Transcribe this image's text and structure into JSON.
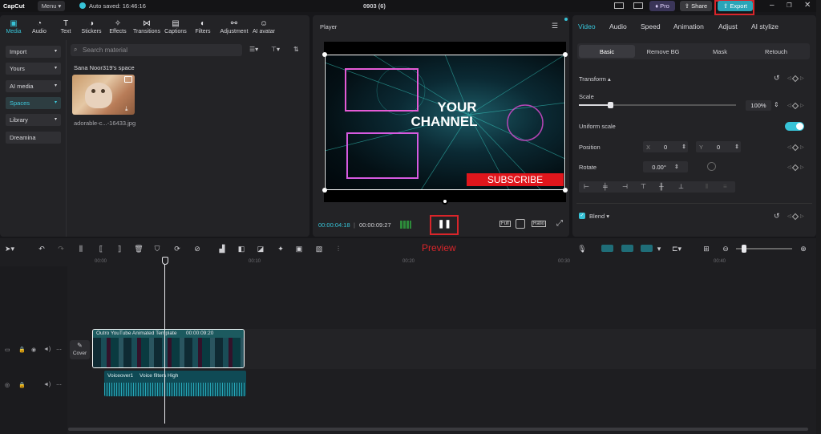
{
  "titlebar": {
    "app_name": "CapCut",
    "menu_label": "Menu",
    "autosave": "Auto saved: 16:46:16",
    "project_name": "0903 (6)",
    "pro_label": "Pro",
    "share_label": "Share",
    "export_label": "Export"
  },
  "toolbar": [
    {
      "label": "Media",
      "icon": "media-icon",
      "active": true
    },
    {
      "label": "Audio",
      "icon": "audio-icon"
    },
    {
      "label": "Text",
      "icon": "text-icon"
    },
    {
      "label": "Stickers",
      "icon": "stickers-icon"
    },
    {
      "label": "Effects",
      "icon": "effects-icon"
    },
    {
      "label": "Transitions",
      "icon": "transitions-icon"
    },
    {
      "label": "Captions",
      "icon": "captions-icon"
    },
    {
      "label": "Filters",
      "icon": "filters-icon"
    },
    {
      "label": "Adjustment",
      "icon": "adjustment-icon"
    },
    {
      "label": "AI avatar",
      "icon": "ai-avatar-icon"
    }
  ],
  "media": {
    "sidebar": [
      "Import",
      "Yours",
      "AI media",
      "Spaces",
      "Library",
      "Dreamina"
    ],
    "search_placeholder": "Search material",
    "space_title": "Sana Noor319's space",
    "file_name": "adorable-c...-16433.jpg"
  },
  "player": {
    "title": "Player",
    "video_text_1": "YOUR",
    "video_text_2": "CHANNEL",
    "subscribe_text": "SUBSCRIBE",
    "current_time": "00:00:04:18",
    "total_time": "00:00:09:27",
    "full_label": "Full",
    "ratio_label": "Ratio"
  },
  "inspector": {
    "tabs": [
      "Video",
      "Audio",
      "Speed",
      "Animation",
      "Adjust",
      "AI stylize"
    ],
    "subtabs": [
      "Basic",
      "Remove BG",
      "Mask",
      "Retouch"
    ],
    "transform_label": "Transform",
    "scale_label": "Scale",
    "scale_value": "100%",
    "scale_fraction": 0.2,
    "uniform_scale_label": "Uniform scale",
    "position_label": "Position",
    "pos_x_label": "X",
    "pos_x": "0",
    "pos_y_label": "Y",
    "pos_y": "0",
    "rotate_label": "Rotate",
    "rotate_value": "0.00°",
    "blend_label": "Blend"
  },
  "timeline": {
    "preview_label": "Preview",
    "ticks": [
      "00:00",
      "00:10",
      "00:20",
      "00:30",
      "00:40"
    ],
    "cover_label": "Cover",
    "video_clip_name": "Outro YouTube Animated Template",
    "video_clip_duration": "00:00:09:20",
    "audio_clip_name": "Voiceover1",
    "audio_clip_effect": "Voice filters High"
  },
  "colors": {
    "accent": "#37c3d7",
    "highlight": "#d9252a",
    "subscribe": "#e0161c"
  }
}
